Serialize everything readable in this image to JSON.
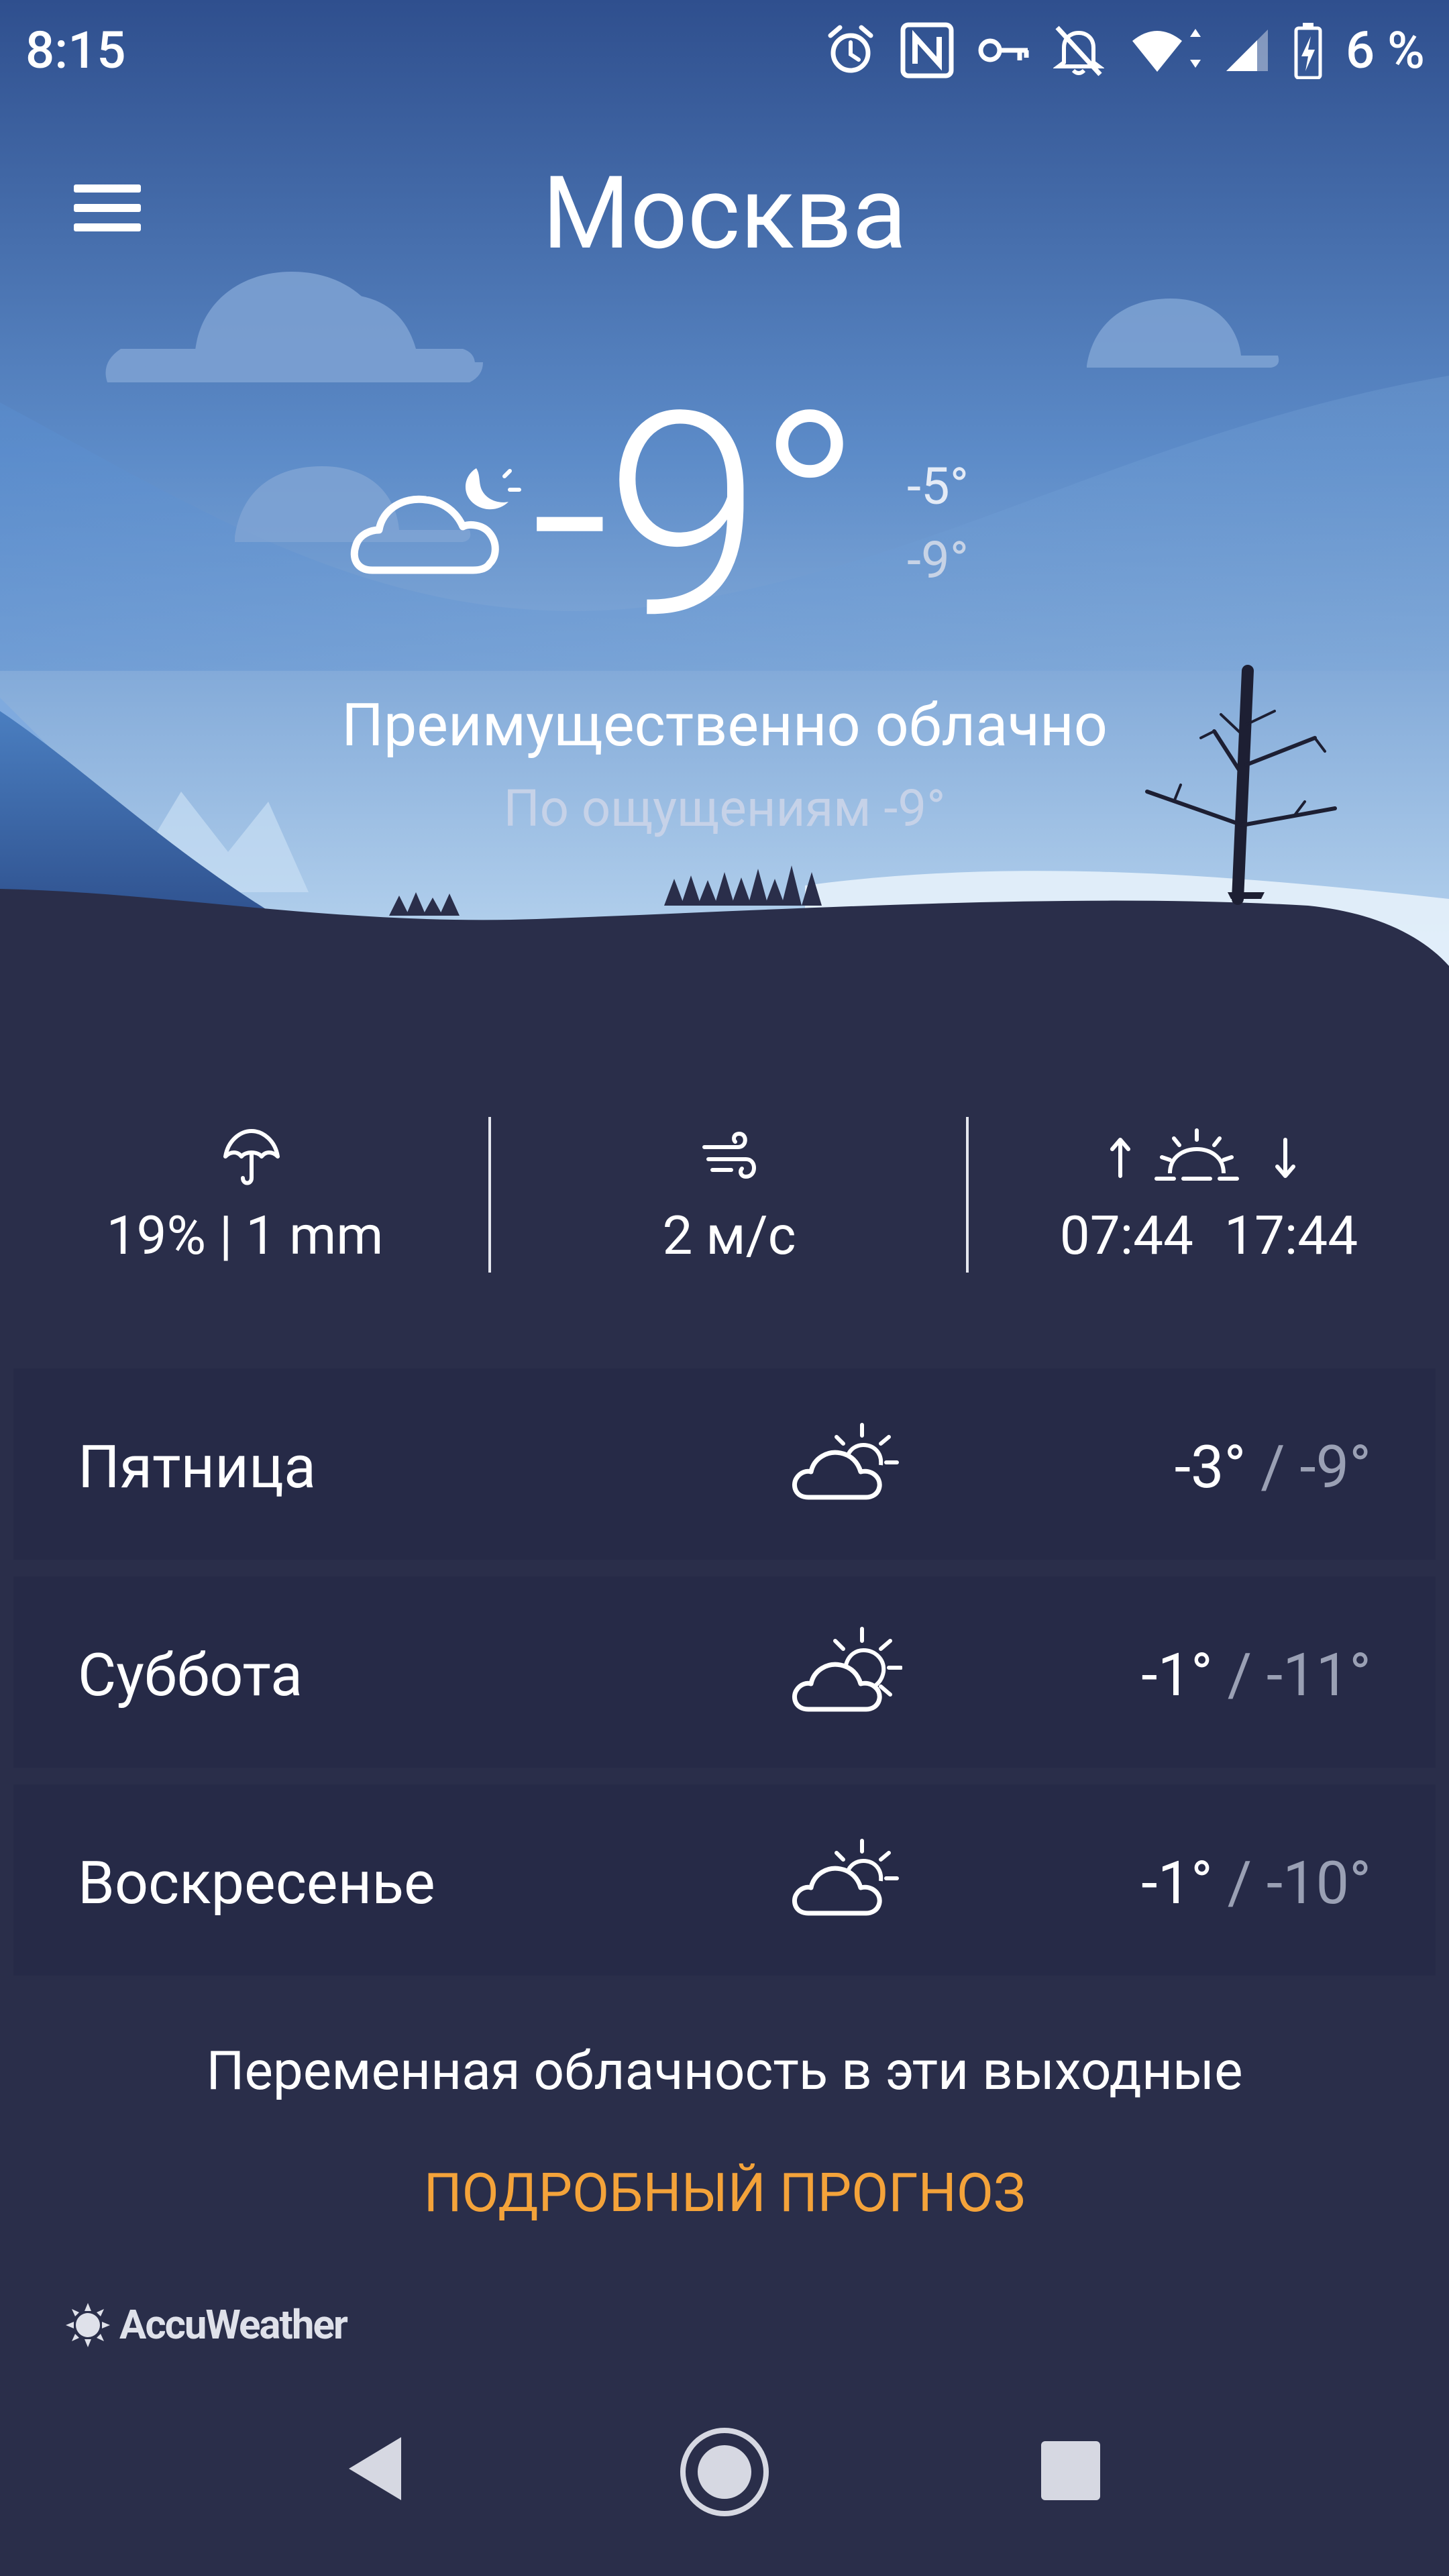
{
  "status_bar": {
    "time": "8:15",
    "battery_percent": "6 %",
    "icons": [
      "alarm-icon",
      "nfc-icon",
      "vpn-key-icon",
      "notifications-off-icon",
      "wifi-icon",
      "signal-icon",
      "battery-icon"
    ]
  },
  "header": {
    "city": "Москва",
    "menu_icon": "hamburger-menu-icon"
  },
  "current": {
    "temperature": "-9°",
    "high": "-5°",
    "low": "-9°",
    "condition": "Преимущественно облачно",
    "feels_like": "По ощущениям -9°",
    "icon": "cloudy-night-icon"
  },
  "stats": {
    "precipitation": {
      "icon": "umbrella-icon",
      "value": "19% | 1 mm"
    },
    "wind": {
      "icon": "wind-icon",
      "value": "2 м/с"
    },
    "sun": {
      "icon": "sunrise-sunset-icon",
      "sunrise": "07:44",
      "sunset": "17:44"
    }
  },
  "forecast": [
    {
      "day": "Пятница",
      "high": "-3°",
      "separator": " / ",
      "low": "-9°",
      "icon": "partly-cloudy-icon"
    },
    {
      "day": "Суббота",
      "high": "-1°",
      "separator": " / ",
      "low": "-11°",
      "icon": "partly-cloudy-icon"
    },
    {
      "day": "Воскресенье",
      "high": "-1°",
      "separator": " / ",
      "low": "-10°",
      "icon": "partly-cloudy-icon"
    }
  ],
  "summary": "Переменная облачность в эти выходные",
  "detail_link": "ПОДРОБНЫЙ ПРОГНОЗ",
  "brand": "AccuWeather",
  "colors": {
    "sky_top": "#2f4f8e",
    "sky_bottom": "#a9cdee",
    "ground": "#2a2e4a",
    "card": "#262a47",
    "accent": "#f4a33a"
  }
}
